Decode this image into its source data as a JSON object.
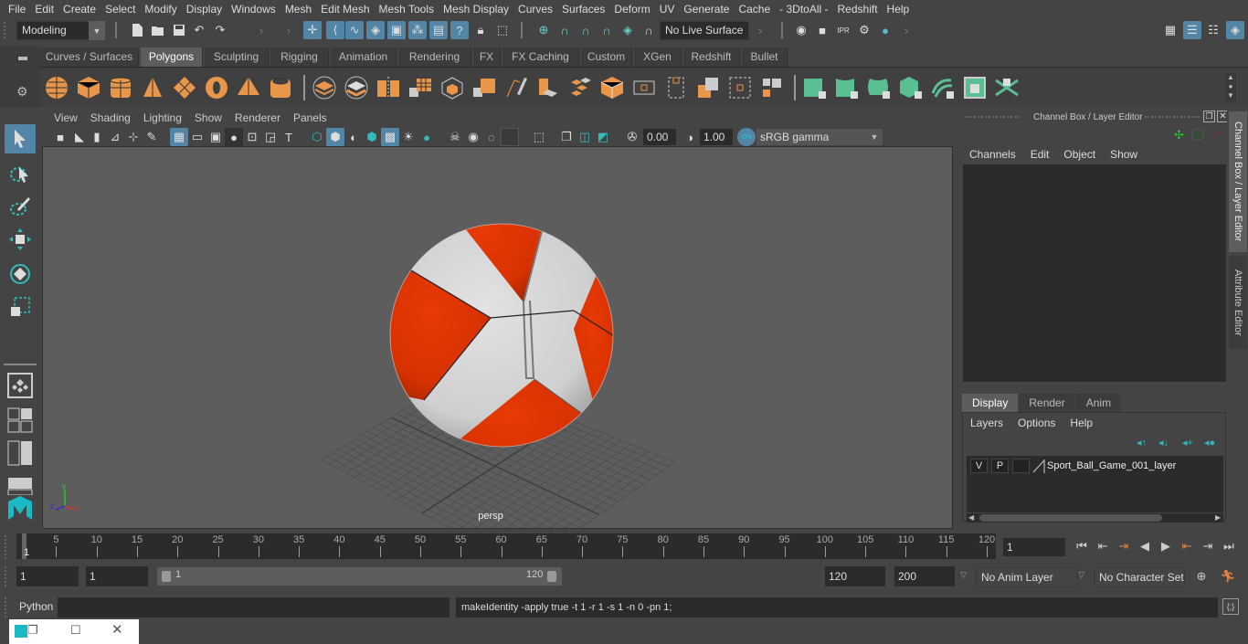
{
  "menubar": [
    "File",
    "Edit",
    "Create",
    "Select",
    "Modify",
    "Display",
    "Windows",
    "Mesh",
    "Edit Mesh",
    "Mesh Tools",
    "Mesh Display",
    "Curves",
    "Surfaces",
    "Deform",
    "UV",
    "Generate",
    "Cache",
    "- 3DtoAll -",
    "Redshift",
    "Help"
  ],
  "status_line": {
    "mode_selector": "Modeling",
    "live_surface": "No Live Surface"
  },
  "shelf": {
    "tabs": [
      "Curves / Surfaces",
      "Polygons",
      "Sculpting",
      "Rigging",
      "Animation",
      "Rendering",
      "FX",
      "FX Caching",
      "Custom",
      "XGen",
      "Redshift",
      "Bullet"
    ],
    "active_tab": "Polygons",
    "icons_poly": [
      "poly-sphere-icon",
      "poly-cube-icon",
      "poly-cylinder-icon",
      "poly-cone-icon",
      "poly-plane-icon",
      "poly-torus-icon",
      "poly-pyramid-icon",
      "poly-pipe-icon"
    ],
    "icons_edit": [
      "combine-icon",
      "separate-icon",
      "mirror-icon",
      "smooth-icon",
      "reduce-icon",
      "boolean-icon",
      "extrude-icon",
      "bevel-icon",
      "bridge-icon",
      "multi-cut-icon",
      "append-icon",
      "target-weld-icon",
      "insert-edge-loop-icon",
      "fill-hole-icon",
      "poke-icon",
      "wedge-icon",
      "split-icon"
    ],
    "icons_uv": [
      "uv-planar-icon",
      "uv-cylindrical-icon",
      "uv-spherical-icon",
      "uv-automatic-icon",
      "uv-unfold-icon",
      "uv-editor-icon",
      "uv-layout-icon"
    ]
  },
  "viewport": {
    "menu": [
      "View",
      "Shading",
      "Lighting",
      "Show",
      "Renderer",
      "Panels"
    ],
    "exposure": "0.00",
    "gamma": "1.00",
    "color_space": "sRGB gamma",
    "color_mgmt_badge": "ON",
    "camera_label": "persp",
    "axis": {
      "x": "x",
      "y": "y",
      "z": "z"
    },
    "colors": {
      "ball_red": "#dd3300",
      "ball_white": "#d6d6d6",
      "grid": "#4e4e4e",
      "background": "#5d5d5d"
    }
  },
  "channel_box": {
    "title": "Channel Box / Layer Editor",
    "menu": [
      "Channels",
      "Edit",
      "Object",
      "Show"
    ]
  },
  "layer_editor": {
    "tabs": [
      "Display",
      "Render",
      "Anim"
    ],
    "active_tab": "Display",
    "menu": [
      "Layers",
      "Options",
      "Help"
    ],
    "layers": [
      {
        "visible": "V",
        "playback": "P",
        "name": "Sport_Ball_Game_001_layer"
      }
    ]
  },
  "side_tabs": [
    "Channel Box / Layer Editor",
    "Attribute Editor"
  ],
  "timeline": {
    "ticks": [
      5,
      10,
      15,
      20,
      25,
      30,
      35,
      40,
      45,
      50,
      55,
      60,
      65,
      70,
      75,
      80,
      85,
      90,
      95,
      100,
      105,
      110,
      115,
      120
    ],
    "range_min": 1,
    "range_max": 120,
    "current_frame_marker": "1",
    "current_frame": "1"
  },
  "range_slider": {
    "start": "1",
    "playback_start": "1",
    "slider_start": "1",
    "slider_end": "120",
    "playback_end": "120",
    "end": "200",
    "anim_layer": "No Anim Layer",
    "character_set": "No Character Set"
  },
  "command_line": {
    "language": "Python",
    "input": "",
    "result": "makeIdentity -apply true -t 1 -r 1 -s 1 -n 0 -pn 1;"
  }
}
